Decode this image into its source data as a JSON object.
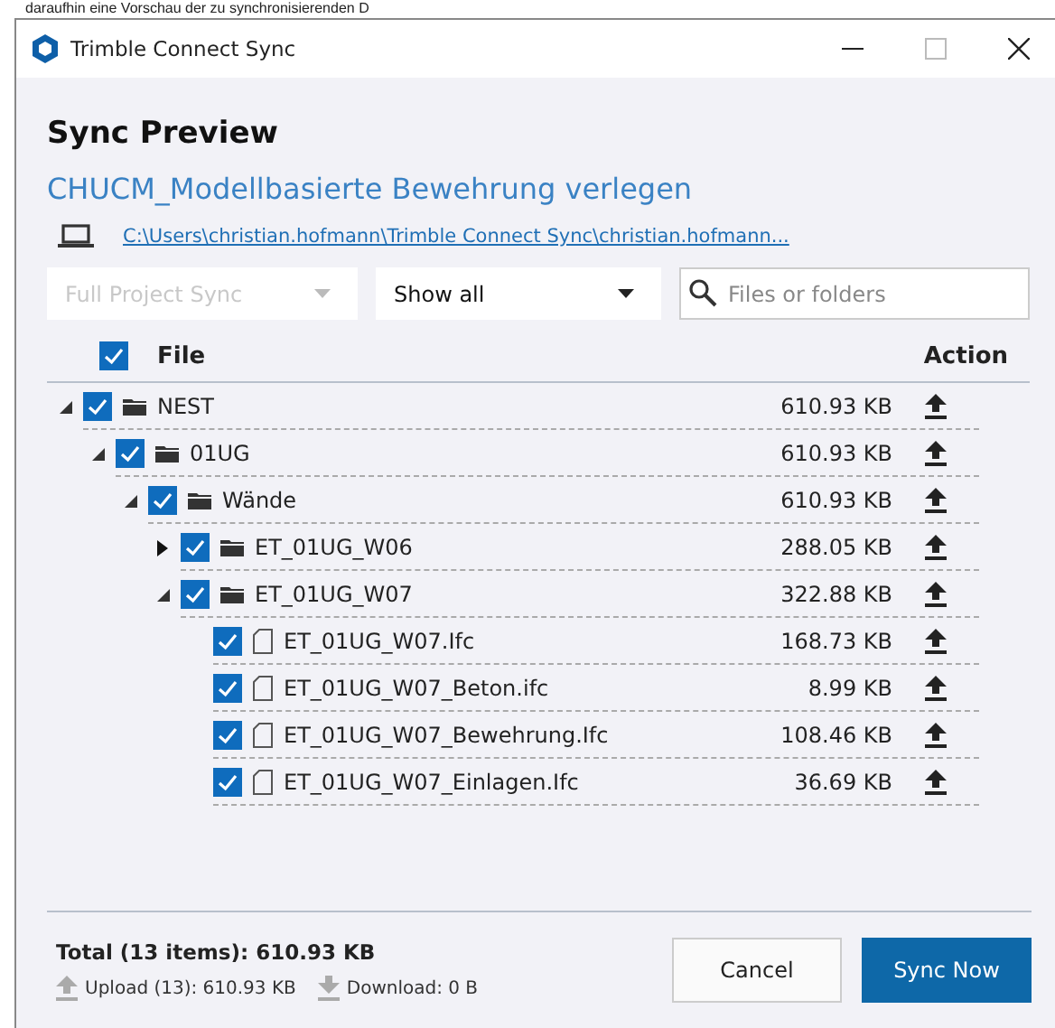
{
  "background_text": "daraufhin eine Vorschau der zu synchronisierenden D",
  "window": {
    "title": "Trimble Connect Sync"
  },
  "heading": "Sync Preview",
  "project": "CHUCM_Modellbasierte Bewehrung verlegen",
  "path": "C:\\Users\\christian.hofmann\\Trimble Connect Sync\\christian.hofmann...",
  "filters": [
    {
      "kind": "dropdown",
      "value": "Full Project Sync",
      "disabled": true
    },
    {
      "kind": "dropdown",
      "value": "Show all",
      "disabled": false
    },
    {
      "kind": "search",
      "placeholder": "Files or folders"
    }
  ],
  "tree": {
    "header_checked": true,
    "columns": [
      "File",
      "Action"
    ],
    "rows": [
      {
        "kind": "folder",
        "name": "NEST",
        "size": "610.93 KB",
        "checked": true,
        "expanded": true,
        "upload": true,
        "children": [
          {
            "kind": "folder",
            "name": "01UG",
            "size": "610.93 KB",
            "checked": true,
            "expanded": true,
            "upload": true,
            "children": [
              {
                "kind": "folder",
                "name": "Wände",
                "size": "610.93 KB",
                "checked": true,
                "expanded": true,
                "upload": true,
                "children": [
                  {
                    "kind": "folder",
                    "name": "ET_01UG_W06",
                    "size": "288.05 KB",
                    "checked": true,
                    "expanded": false,
                    "upload": true
                  },
                  {
                    "kind": "folder",
                    "name": "ET_01UG_W07",
                    "size": "322.88 KB",
                    "checked": true,
                    "expanded": true,
                    "upload": true,
                    "children": [
                      {
                        "kind": "file",
                        "name": "ET_01UG_W07.Ifc",
                        "size": "168.73 KB",
                        "checked": true,
                        "upload": true
                      },
                      {
                        "kind": "file",
                        "name": "ET_01UG_W07_Beton.ifc",
                        "size": "8.99 KB",
                        "checked": true,
                        "upload": true
                      },
                      {
                        "kind": "file",
                        "name": "ET_01UG_W07_Bewehrung.Ifc",
                        "size": "108.46 KB",
                        "checked": true,
                        "upload": true
                      },
                      {
                        "kind": "file",
                        "name": "ET_01UG_W07_Einlagen.Ifc",
                        "size": "36.69 KB",
                        "checked": true,
                        "upload": true
                      }
                    ]
                  }
                ]
              }
            ]
          }
        ]
      }
    ]
  },
  "footer": {
    "total": "Total (13 items): 610.93 KB",
    "upload": "Upload (13): 610.93 KB",
    "download": "Download: 0 B",
    "buttons": [
      {
        "kind": "secondary",
        "label": "Cancel"
      },
      {
        "kind": "primary",
        "label": "Sync Now"
      }
    ]
  }
}
